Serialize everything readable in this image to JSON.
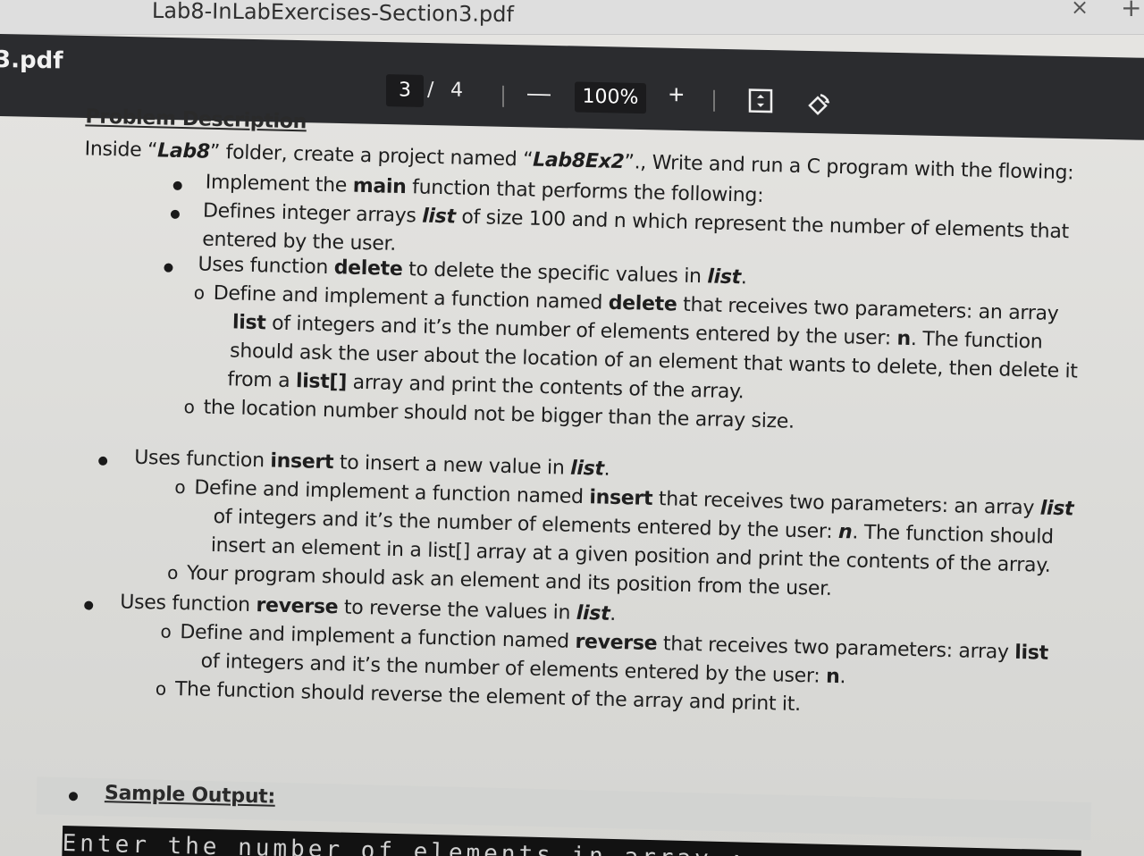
{
  "browser": {
    "tab_title": "Lab8-InLabExercises-Section3.pdf",
    "close_glyph": "×",
    "new_tab_glyph": "+"
  },
  "viewer": {
    "doc_name": "3.pdf",
    "current_page": "3",
    "page_separator": "/",
    "total_pages": "4",
    "zoom_out_label": "—",
    "zoom_level": "100%",
    "zoom_in_label": "+",
    "icons": {
      "fit": "fit-page-icon",
      "rotate": "rotate-icon"
    }
  },
  "content": {
    "heading": "Problem Description",
    "intro": {
      "a": "Inside “",
      "b": "Lab8",
      "c": "” folder, create a project named “",
      "d": "Lab8Ex2",
      "e": "”., Write and run a C program with the flowing:"
    },
    "b1": {
      "a": "Implement the ",
      "b": "main",
      "c": " function that performs the following:"
    },
    "b2": {
      "a": "Defines integer arrays ",
      "b": "list",
      "c": " of size 100 and n which represent the number of elements that",
      "d": "entered by the user."
    },
    "b3": {
      "a": "Uses function ",
      "b": "delete",
      "c": " to delete the specific values in ",
      "d": "list",
      "e": "."
    },
    "b3s1": {
      "l1a": "Define and implement a function named ",
      "l1b": "delete",
      "l1c": " that receives two parameters: an array",
      "l2a": "list",
      "l2b": " of integers and it’s the number of elements entered by the user: ",
      "l2c": "n",
      "l2d": ". The function",
      "l3": "should ask the user about the location of an element that wants to delete, then delete it",
      "l4a": "from a ",
      "l4b": "list[]",
      "l4c": " array and print the contents of the array."
    },
    "b3s2": "the location number should not be bigger than the array size.",
    "b4": {
      "a": "Uses function ",
      "b": "insert",
      "c": " to insert a new value in ",
      "d": "list",
      "e": "."
    },
    "b4s1": {
      "l1a": "Define and implement a function named ",
      "l1b": "insert",
      "l1c": " that receives two parameters: an array ",
      "l1d": "list",
      "l2a": "of integers and it’s the number of elements entered by the user: ",
      "l2b": "n",
      "l2c": ". The function should",
      "l3": "insert an element in a list[] array at a given position and print the contents of the array."
    },
    "b4s2": "Your program should ask an element and its position from the user.",
    "b5": {
      "a": "Uses function ",
      "b": "reverse",
      "c": " to reverse the values in ",
      "d": "list",
      "e": "."
    },
    "b5s1": {
      "l1a": "Define and implement a function named ",
      "l1b": "reverse",
      "l1c": " that receives two parameters: array ",
      "l1d": "list",
      "l2a": "of integers and it’s the number of elements entered by the user: ",
      "l2b": "n",
      "l2c": "."
    },
    "b5s2": "The function should reverse the element of the array and print it.",
    "sample_heading": "Sample Output:",
    "terminal_line": "Enter the number of elements in array :",
    "sub_bullet_glyph": "o"
  }
}
